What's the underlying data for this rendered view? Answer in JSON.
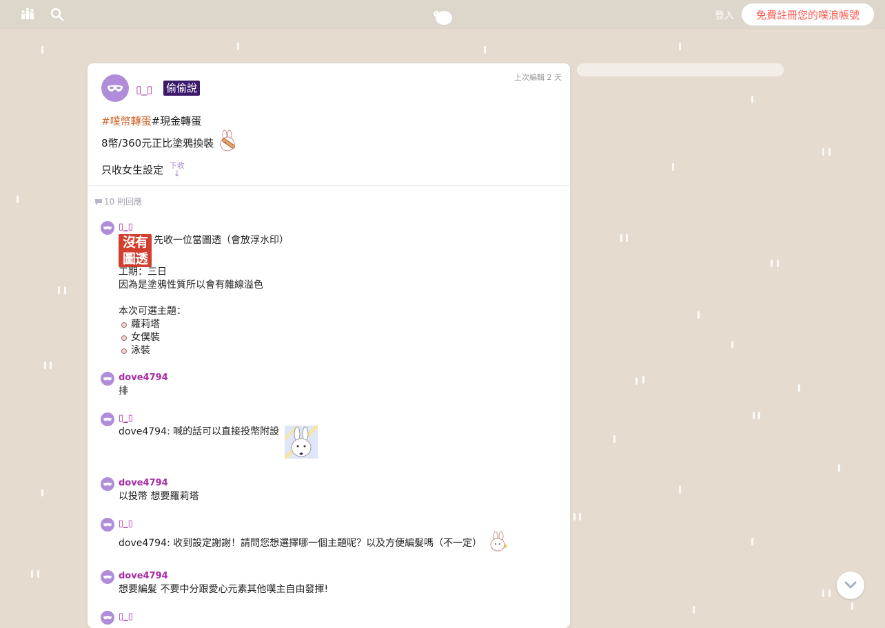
{
  "topbar": {
    "login_label": "登入",
    "signup_label": "免費註冊您的噗浪帳號",
    "accent_color": "#ff574d"
  },
  "post": {
    "author": "▯_▯",
    "qualifier": "偷偷說",
    "time": "上次編輯 2 天",
    "hashtag_1": "#噗幣轉蛋",
    "hashtag_2": "#現金轉蛋",
    "line_2": "8幣/360元正比塗鴉換裝",
    "line_3": "只收女生設定",
    "collapse_label": "下收",
    "collapse_arrow": "↓"
  },
  "reply_count": "10 則回應",
  "responses": [
    {
      "name": "▯_▯",
      "badge_top": "沒有",
      "badge_bottom": "圖透",
      "first_line": "先收一位當圖透（會放浮水印）",
      "line_a": "工期：三日",
      "line_b": "因為是塗鴉性質所以會有雜線溢色",
      "topics_heading": "本次可選主題：",
      "topics": [
        "蘿莉塔",
        "女僕裝",
        "泳裝"
      ]
    },
    {
      "name": "dove4794",
      "text": "排"
    },
    {
      "name": "▯_▯",
      "text": "dove4794: 喊的話可以直接投幣附設"
    },
    {
      "name": "dove4794",
      "text": "以投幣 想要羅莉塔"
    },
    {
      "name": "▯_▯",
      "text": "dove4794: 收到設定謝謝！請問您想選擇哪一個主題呢？以及方便編髮嗎（不一定）"
    },
    {
      "name": "dove4794",
      "text": "想要編髮 不要中分跟愛心元素其他噗主自由發揮!"
    },
    {
      "name": "▯_▯",
      "text": ""
    }
  ]
}
